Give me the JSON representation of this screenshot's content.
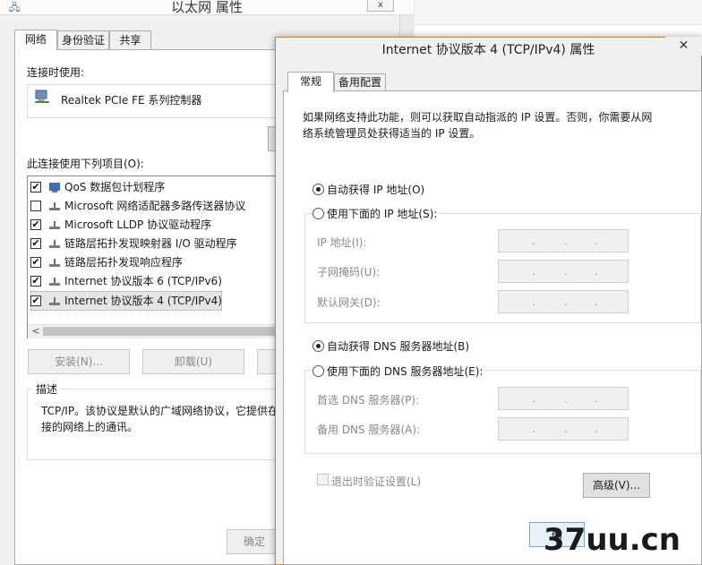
{
  "background_window": {
    "title": "以太网 属性",
    "close_label": "x",
    "tabs": [
      "网络",
      "身份验证",
      "共享"
    ],
    "connect_using_label": "连接时使用:",
    "adapter_name": "Realtek PCIe FE 系列控制器",
    "items_label": "此连接使用下列项目(O):",
    "items": [
      {
        "checked": true,
        "label": "QoS 数据包计划程序"
      },
      {
        "checked": false,
        "label": "Microsoft 网络适配器多路传送器协议"
      },
      {
        "checked": true,
        "label": "Microsoft LLDP 协议驱动程序"
      },
      {
        "checked": true,
        "label": "链路层拓扑发现映射器 I/O 驱动程序"
      },
      {
        "checked": true,
        "label": "链路层拓扑发现响应程序"
      },
      {
        "checked": true,
        "label": "Internet 协议版本 6 (TCP/IPv6)"
      },
      {
        "checked": true,
        "label": "Internet 协议版本 4 (TCP/IPv4)"
      }
    ],
    "scroll_left": "<",
    "install_button": "安装(N)...",
    "uninstall_button": "卸载(U)",
    "description_title": "描述",
    "description_line1": "TCP/IP。该协议是默认的广域网络协议，它提供在",
    "description_line2": "接的网络上的通讯。",
    "ok_button": "确定"
  },
  "dialog": {
    "title": "Internet 协议版本 4 (TCP/IPv4) 属性",
    "close_label": "✕",
    "tabs": [
      "常规",
      "备用配置"
    ],
    "intro_line1": "如果网络支持此功能，则可以获取自动指派的 IP 设置。否则，你需要从网",
    "intro_line2": "络系统管理员处获得适当的 IP 设置。",
    "auto_ip": "自动获得 IP 地址(O)",
    "manual_ip": "使用下面的 IP 地址(S):",
    "ip_address_label": "IP 地址(I):",
    "subnet_label": "子网掩码(U):",
    "gateway_label": "默认网关(D):",
    "auto_dns": "自动获得 DNS 服务器地址(B)",
    "manual_dns": "使用下面的 DNS 服务器地址(E):",
    "preferred_dns_label": "首选 DNS 服务器(P):",
    "alternate_dns_label": "备用 DNS 服务器(A):",
    "ip_dot": ".",
    "validate_label": "退出时验证设置(L)",
    "advanced_button": "高级(V)...",
    "ok_button": "确"
  },
  "watermark": "37uu.cn"
}
